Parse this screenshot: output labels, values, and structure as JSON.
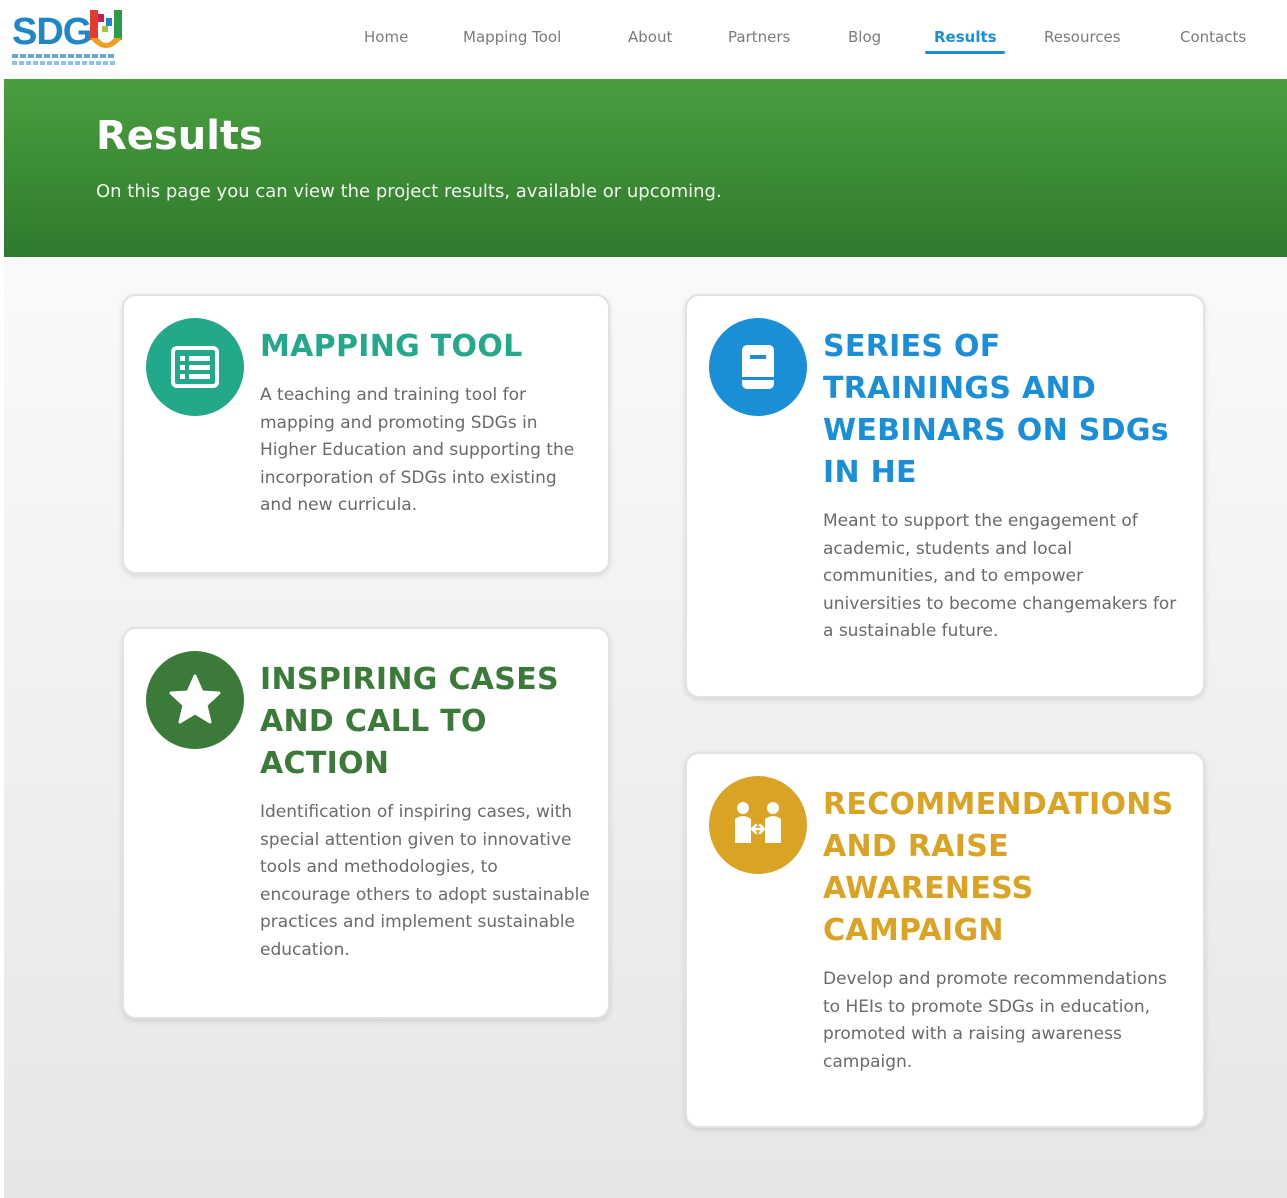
{
  "logo": {
    "text": "SDG",
    "letter": "U"
  },
  "nav": {
    "items": [
      {
        "label": "Home"
      },
      {
        "label": "Mapping Tool"
      },
      {
        "label": "About"
      },
      {
        "label": "Partners"
      },
      {
        "label": "Blog"
      },
      {
        "label": "Results"
      },
      {
        "label": "Resources"
      },
      {
        "label": "Contacts"
      }
    ],
    "active": "Results"
  },
  "hero": {
    "title": "Results",
    "subtitle": "On this page you can view the project results, available or upcoming."
  },
  "cards": [
    {
      "icon": "list-icon",
      "title": "MAPPING TOOL",
      "description": "A teaching and training tool for mapping and promoting SDGs in Higher Education and supporting the incorporation of SDGs into existing and new curricula.",
      "color": "#24a88a"
    },
    {
      "icon": "book-icon",
      "title": "SERIES OF TRAININGS AND WEBINARS ON SDGs IN HE",
      "description": "Meant to support the engagement of academic, students and local communities, and to empower universities to become changemakers for a sustainable future.",
      "color": "#1a8fd8"
    },
    {
      "icon": "star-icon",
      "title": "INSPIRING CASES AND CALL TO ACTION",
      "description": "Identification of inspiring cases, with special attention given to innovative tools and methodologies, to encourage others to adopt sustainable practices and implement sustainable education.",
      "color": "#3b7a38"
    },
    {
      "icon": "people-exchange-icon",
      "title": "RECOMMENDATIONS AND RAISE AWARENESS CAMPAIGN",
      "description": "Develop and promote recommendations to HEIs to promote SDGs in education, promoted with a raising awareness campaign.",
      "color": "#dba324"
    }
  ],
  "colors": {
    "hero_green": "#3b8a36",
    "accent_blue": "#1a8fd8"
  }
}
